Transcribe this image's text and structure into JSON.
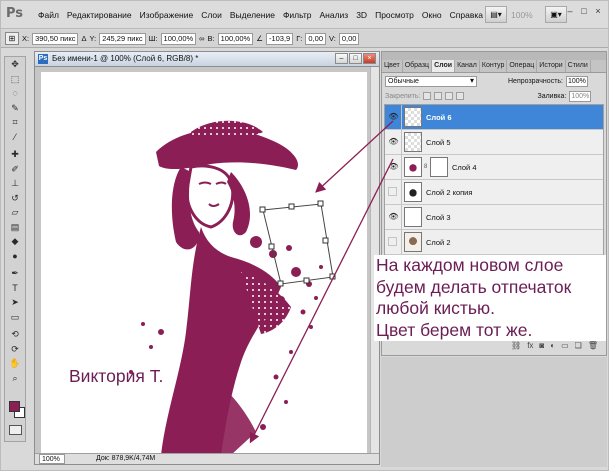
{
  "menubar": {
    "logo": "Ps",
    "items": [
      "Файл",
      "Редактирование",
      "Изображение",
      "Слои",
      "Выделение",
      "Фильтр",
      "Анализ",
      "3D",
      "Просмотр",
      "Окно",
      "Справка"
    ],
    "zoom": "100%",
    "window_controls": [
      "–",
      "□",
      "×"
    ]
  },
  "options_bar": {
    "x_label": "X:",
    "x_value": "390,50 пикс",
    "y_label": "Y:",
    "y_value": "245,29 пикс",
    "w_label": "Ш:",
    "w_value": "100,00%",
    "h_label": "В:",
    "h_value": "100,00%",
    "angle_value": "-103,9",
    "hskew_label": "Г:",
    "hskew_value": "0,00",
    "vskew_label": "V:",
    "vskew_value": "0,00"
  },
  "document": {
    "title": "Без имени-1 @ 100% (Слой 6, RGB/8) *",
    "status_zoom": "100%",
    "status_doc": "Док: 878,9K/4,74M",
    "signature": "Виктория Т."
  },
  "annotation": {
    "lines": [
      "На каждом новом слое",
      "будем делать отпечаток",
      "любой кистью.",
      "Цвет берем тот же."
    ]
  },
  "layers_panel": {
    "tabs": [
      "Цвет",
      "Образц",
      "Слои",
      "Канал",
      "Контур",
      "Операц",
      "Истори",
      "Стили"
    ],
    "active_tab": "Слои",
    "blend_mode": "Обычные",
    "opacity_label": "Непрозрачность:",
    "opacity_value": "100%",
    "lock_label": "Закрепить:",
    "fill_label": "Заливка:",
    "fill_value": "100%",
    "layers": [
      {
        "name": "Слой 6",
        "visible": true,
        "selected": true
      },
      {
        "name": "Слой 5",
        "visible": true,
        "selected": false
      },
      {
        "name": "Слой 4",
        "visible": true,
        "selected": false
      },
      {
        "name": "Слой 2 копия",
        "visible": false,
        "selected": false
      },
      {
        "name": "Слой 3",
        "visible": true,
        "selected": false
      },
      {
        "name": "Слой 2",
        "visible": false,
        "selected": false
      }
    ]
  },
  "colors": {
    "accent": "#8b1f55",
    "annotation_text": "#6b1d55",
    "selected_layer": "#3f86d8"
  }
}
